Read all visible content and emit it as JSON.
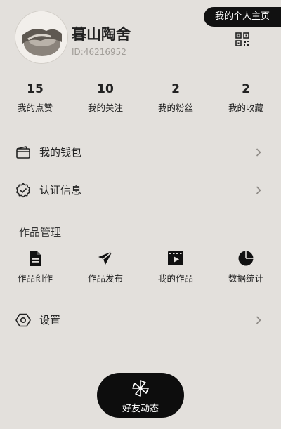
{
  "profile": {
    "name": "暮山陶舍",
    "id": "ID:46216952",
    "home_button": "我的个人主页"
  },
  "stats": [
    {
      "value": "15",
      "label": "我的点赞"
    },
    {
      "value": "10",
      "label": "我的关注"
    },
    {
      "value": "2",
      "label": "我的粉丝"
    },
    {
      "value": "2",
      "label": "我的收藏"
    }
  ],
  "menu": {
    "wallet": "我的钱包",
    "certification": "认证信息",
    "settings": "设置"
  },
  "works": {
    "title": "作品管理",
    "items": [
      {
        "label": "作品创作",
        "icon": "document-icon"
      },
      {
        "label": "作品发布",
        "icon": "send-icon"
      },
      {
        "label": "我的作品",
        "icon": "video-icon"
      },
      {
        "label": "数据统计",
        "icon": "pie-chart-icon"
      }
    ]
  },
  "fab": {
    "label": "好友动态",
    "icon": "pinwheel-icon"
  },
  "colors": {
    "background": "#e3e0dc",
    "accent": "#111111",
    "text": "#222222",
    "muted": "#a19d98"
  }
}
